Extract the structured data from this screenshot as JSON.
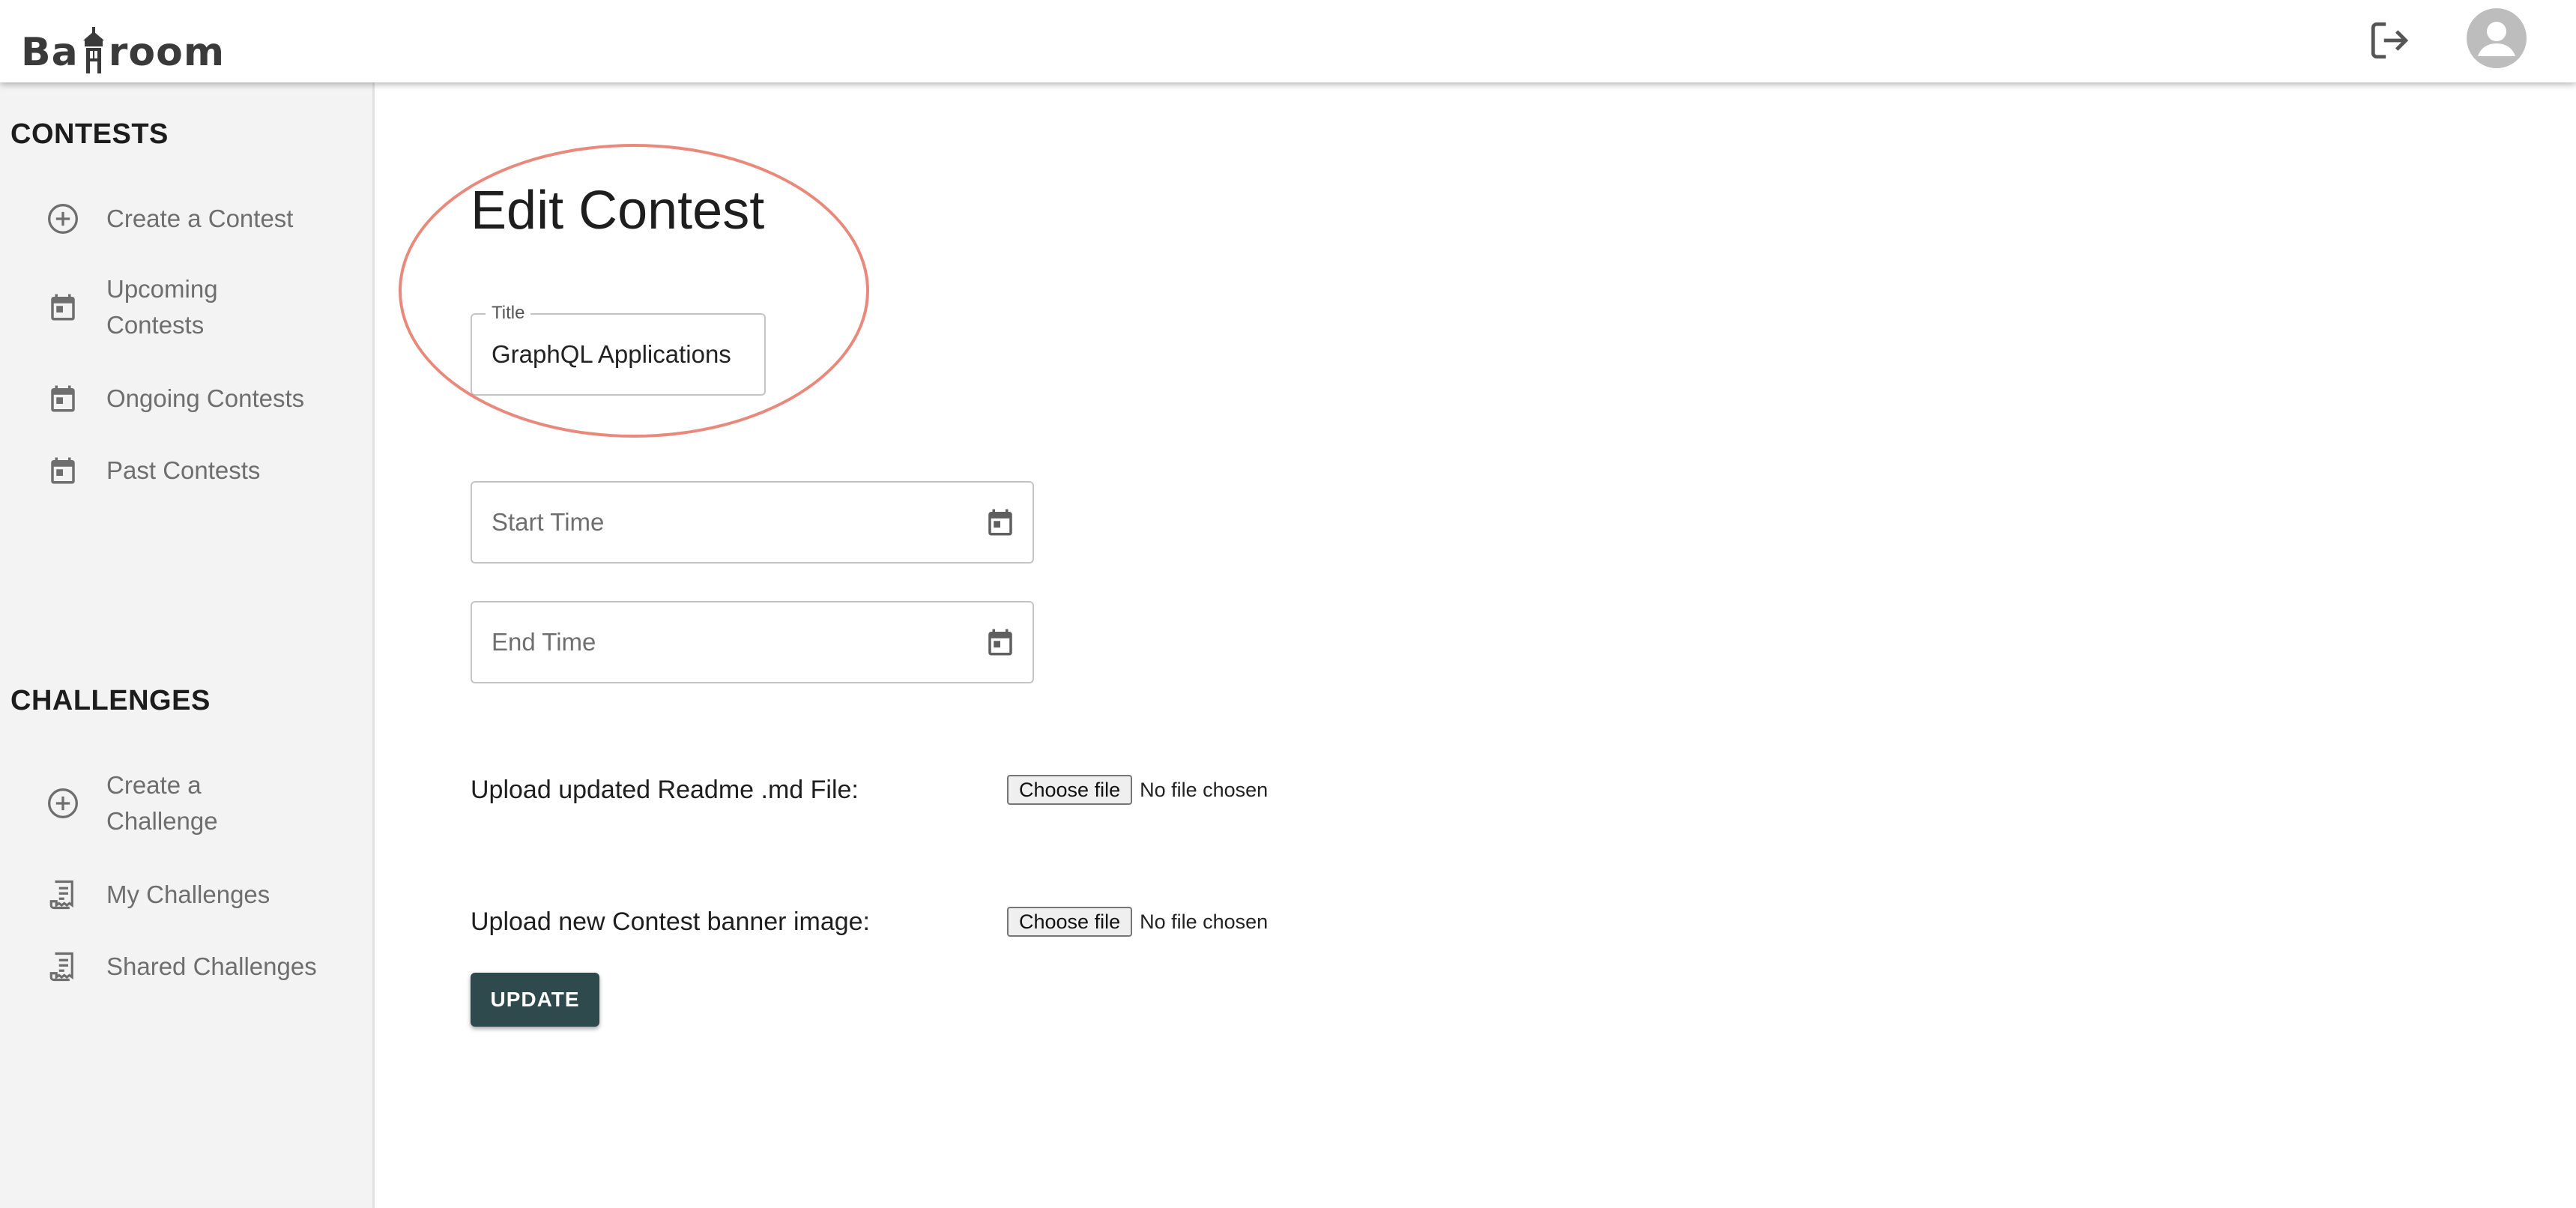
{
  "app": {
    "logo_text_start": "Ba",
    "logo_text_end": "room",
    "logo_icon": "bell-tower-icon"
  },
  "header": {
    "logout_icon": "logout-icon",
    "avatar_icon": "account-circle-icon"
  },
  "sidebar": {
    "contests_title": "CONTESTS",
    "contests_items": [
      {
        "label": "Create a Contest",
        "icon": "add-circle-icon"
      },
      {
        "label": "Upcoming Contests",
        "icon": "calendar-icon"
      },
      {
        "label": "Ongoing Contests",
        "icon": "calendar-icon"
      },
      {
        "label": "Past Contests",
        "icon": "calendar-icon"
      }
    ],
    "challenges_title": "CHALLENGES",
    "challenges_items": [
      {
        "label": "Create a Challenge",
        "icon": "add-circle-icon"
      },
      {
        "label": "My Challenges",
        "icon": "receipt-icon"
      },
      {
        "label": "Shared Challenges",
        "icon": "receipt-icon"
      }
    ]
  },
  "main": {
    "title": "Edit Contest",
    "title_field": {
      "label": "Title",
      "value": "GraphQL Applications"
    },
    "start_time": {
      "placeholder": "Start Time"
    },
    "end_time": {
      "placeholder": "End Time"
    },
    "readme_upload": {
      "label": "Upload updated Readme .md File:",
      "button": "Choose file",
      "status": "No file chosen"
    },
    "banner_upload": {
      "label": "Upload new Contest banner image:",
      "button": "Choose file",
      "status": "No file chosen"
    },
    "update_button": "UPDATE"
  },
  "colors": {
    "accent": "#2f4a4d",
    "highlight": "#e8897c",
    "sidebar_bg": "#f3f3f3"
  }
}
